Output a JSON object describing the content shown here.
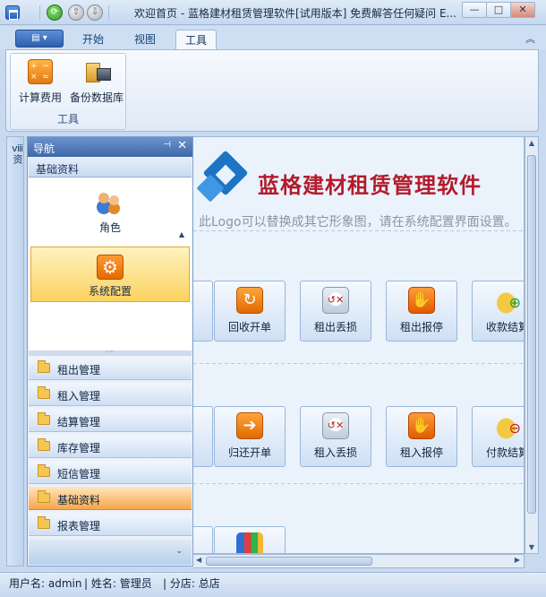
{
  "window": {
    "title": "欢迎首页 - 蓝格建材租赁管理软件[试用版本] 免费解答任何疑问 E...",
    "minimize": "—",
    "maximize": "□",
    "close": "✕"
  },
  "ribbon": {
    "file_btn": "▤ ▾",
    "tabs": [
      "开始",
      "视图",
      "工具"
    ],
    "active_tab": "工具",
    "collapse": "︽",
    "group": {
      "label": "工具",
      "buttons": [
        {
          "label": "计算费用",
          "icon": "calculator-icon"
        },
        {
          "label": "备份数据库",
          "icon": "backup-database-icon"
        }
      ]
    }
  },
  "side_strip": {
    "label": "ⅷ资"
  },
  "nav": {
    "title": "导航",
    "pin": "⊣",
    "close": "✕",
    "section": "基础资料",
    "items": [
      {
        "label": "角色",
        "icon": "role-users-icon"
      },
      {
        "label": "系统配置",
        "icon": "gear-icon",
        "selected": true
      }
    ],
    "groups": [
      {
        "label": "租出管理"
      },
      {
        "label": "租入管理"
      },
      {
        "label": "结算管理"
      },
      {
        "label": "库存管理"
      },
      {
        "label": "短信管理"
      },
      {
        "label": "基础资料",
        "active": true
      },
      {
        "label": "报表管理"
      }
    ],
    "footer_chevron": "⌄"
  },
  "main": {
    "logo_title": "蓝格建材租赁管理软件",
    "logo_note": "此Logo可以替换成其它形象图，请在系统配置界面设置。",
    "row1": [
      {
        "label": "回收开单",
        "icon": "return-receipt-icon"
      },
      {
        "label": "租出丢损",
        "icon": "rental-loss-icon"
      },
      {
        "label": "租出报停",
        "icon": "rental-stop-hand-icon"
      },
      {
        "label": "收款结算",
        "icon": "coins-add-icon"
      }
    ],
    "row2": [
      {
        "label": "归还开单",
        "icon": "arrow-return-icon"
      },
      {
        "label": "租入丢损",
        "icon": "rental-in-loss-icon"
      },
      {
        "label": "租入报停",
        "icon": "rental-in-stop-hand-icon"
      },
      {
        "label": "付款结算",
        "icon": "coins-remove-icon"
      }
    ],
    "row3": [
      {
        "label": "",
        "icon": "report-chart-icon"
      }
    ]
  },
  "statusbar": {
    "user": "用户名: admin",
    "name": "| 姓名: 管理员",
    "branch": "| 分店: 总店"
  }
}
